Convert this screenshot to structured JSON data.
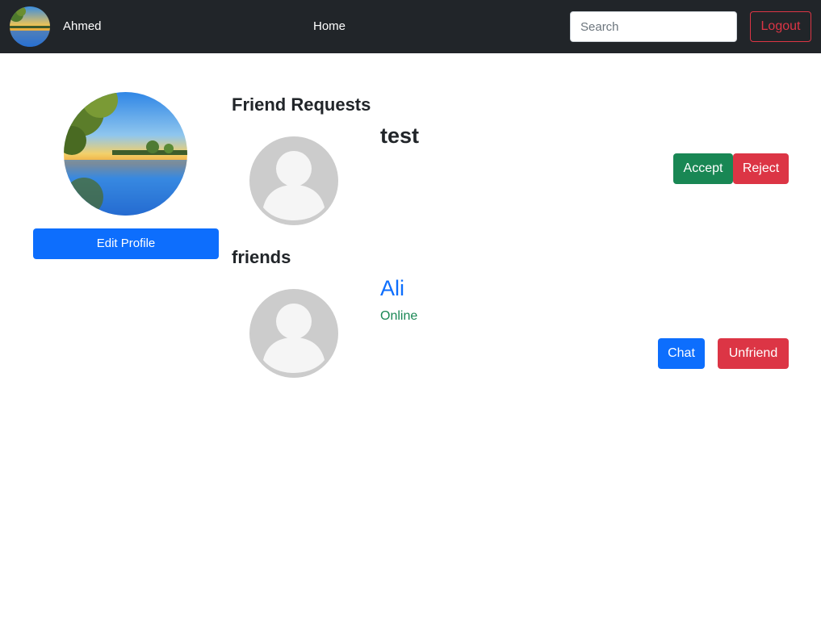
{
  "navbar": {
    "username": "Ahmed",
    "home_label": "Home",
    "search_placeholder": "Search",
    "logout_label": "Logout"
  },
  "profile": {
    "edit_label": "Edit Profile"
  },
  "friend_requests": {
    "title": "Friend Requests",
    "items": [
      {
        "name": "test",
        "accept_label": "Accept",
        "reject_label": "Reject"
      }
    ]
  },
  "friends": {
    "title": "friends",
    "items": [
      {
        "name": "Ali",
        "status": "Online",
        "chat_label": "Chat",
        "unfriend_label": "Unfriend"
      }
    ]
  },
  "colors": {
    "navbar_bg": "#212529",
    "primary": "#0d6efd",
    "success": "#198754",
    "danger": "#dc3545",
    "avatar_placeholder": "#cccccc"
  }
}
